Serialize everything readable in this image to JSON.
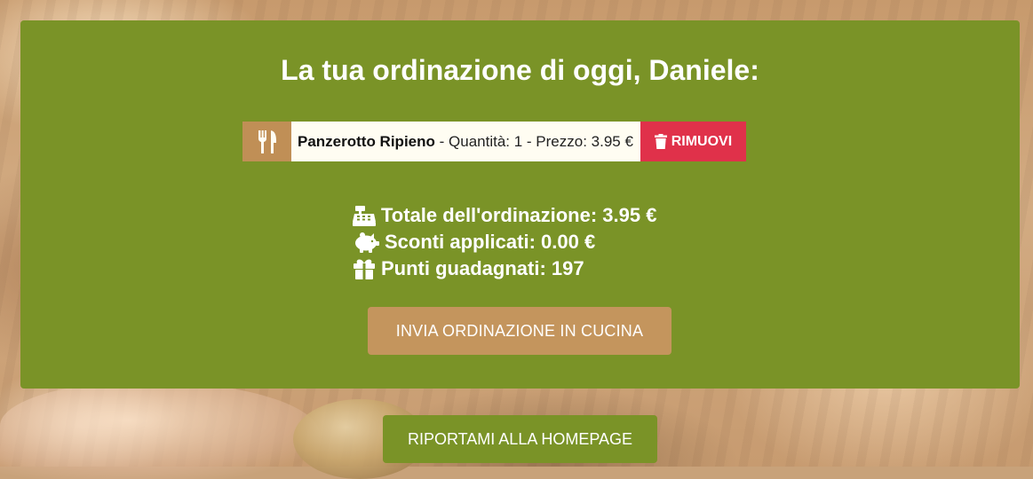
{
  "page": {
    "title": "La tua ordinazione di oggi, Daniele:"
  },
  "order": {
    "items": [
      {
        "icon": "utensils-icon",
        "name": "Panzerotto Ripieno",
        "details": " - Quantità: 1 - Prezzo: 3.95 €",
        "remove_label": "RIMUOVI"
      }
    ]
  },
  "summary": {
    "total": {
      "icon": "cash-register-icon",
      "text": "Totale dell'ordinazione: 3.95 €"
    },
    "discounts": {
      "icon": "piggy-bank-icon",
      "text": "Sconti applicati: 0.00 €"
    },
    "points": {
      "icon": "gift-icon",
      "text": "Punti guadagnati: 197"
    }
  },
  "actions": {
    "send_label": "INVIA ORDINAZIONE IN CUCINA",
    "home_label": "RIPORTAMI ALLA HOMEPAGE"
  },
  "colors": {
    "panel": "#7a9327",
    "accent_tan": "#c4955d",
    "remove_red": "#e0314a",
    "item_bg": "#fffdf2"
  }
}
